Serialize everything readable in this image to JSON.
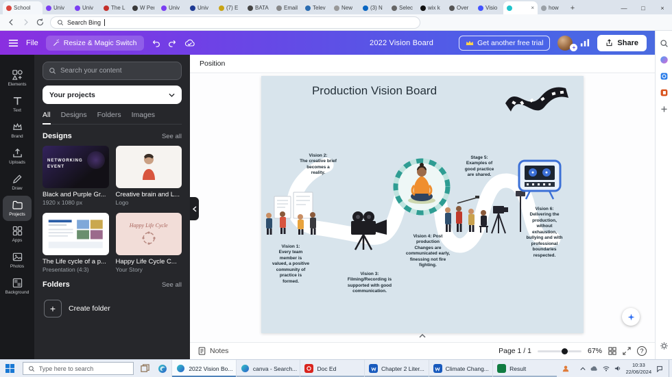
{
  "colors": {
    "toolbar_gradient_start": "#8a2fe0",
    "toolbar_gradient_end": "#4a6ae0",
    "page_background": "#d8e4ec",
    "panel_background": "#26272b"
  },
  "browser": {
    "tabs": [
      {
        "label": "School",
        "color": "#d9463e"
      },
      {
        "label": "Univ",
        "color": "#7b3ff2"
      },
      {
        "label": "Univ",
        "color": "#7b3ff2"
      },
      {
        "label": "The L",
        "color": "#c4302b"
      },
      {
        "label": "W Perel",
        "color": "#3a3a3a"
      },
      {
        "label": "Univ",
        "color": "#7b3ff2"
      },
      {
        "label": "Univ",
        "color": "#1f3a93"
      },
      {
        "label": "(7) E",
        "color": "#c8a415"
      },
      {
        "label": "BATA",
        "color": "#444444"
      },
      {
        "label": "Email",
        "color": "#888888"
      },
      {
        "label": "Telev",
        "color": "#2b6cb0"
      },
      {
        "label": "New",
        "color": "#999999"
      },
      {
        "label": "(3) N",
        "color": "#0a66c2"
      },
      {
        "label": "Selec",
        "color": "#666666"
      },
      {
        "label": "wix k",
        "color": "#111111"
      },
      {
        "label": "Over",
        "color": "#555555"
      },
      {
        "label": "Visio",
        "color": "#4353ff"
      },
      {
        "label": "",
        "color": "#20c4cb"
      },
      {
        "label": "how",
        "color": "#9aa0a6"
      }
    ],
    "tab_close_glyph": "×",
    "new_tab_label": "+",
    "window_controls": {
      "minimize": "—",
      "maximize": "□",
      "close": "×"
    },
    "address": {
      "value": "Search Bing"
    }
  },
  "toolbar": {
    "file_label": "File",
    "resize_label": "Resize & Magic Switch",
    "design_title": "2022  Vision Board",
    "trial_label": "Get another free trial",
    "share_label": "Share"
  },
  "position_bar": {
    "label": "Position"
  },
  "rail": {
    "items": [
      {
        "label": "Elements"
      },
      {
        "label": "Text"
      },
      {
        "label": "Brand"
      },
      {
        "label": "Uploads"
      },
      {
        "label": "Draw"
      },
      {
        "label": "Projects"
      },
      {
        "label": "Apps"
      },
      {
        "label": "Photos"
      },
      {
        "label": "Background"
      }
    ]
  },
  "panel": {
    "search_placeholder": "Search your content",
    "filter_label": "Your projects",
    "tabs": [
      {
        "label": "All"
      },
      {
        "label": "Designs"
      },
      {
        "label": "Folders"
      },
      {
        "label": "Images"
      }
    ],
    "designs_header": "Designs",
    "see_all": "See all",
    "designs": [
      {
        "title": "Black and Purple Gr...",
        "meta": "1920 x 1080 px",
        "thumb_line1": "NETWORKING",
        "thumb_line2": "EVENT"
      },
      {
        "title": "Creative brain and L...",
        "meta": "Logo"
      },
      {
        "title": "The Life cycle of a p...",
        "meta": "Presentation (4:3)"
      },
      {
        "title": "Happy Life Cycle C...",
        "meta": "Your Story",
        "thumb_script": "Happy Life Cycle"
      }
    ],
    "folders_header": "Folders",
    "create_folder_label": "Create folder",
    "create_folder_glyph": "+"
  },
  "canvas": {
    "title": "Production Vision Board",
    "labels": [
      {
        "text": "Vision 2:\nThe creative brief\nbecomes a\nreality."
      },
      {
        "text": "Vision 1:\nEvery team\nmember is\nvalued, a positive\ncommunity of\npractice is\nformed."
      },
      {
        "text": "Vision 3:\nFilming/Recording is\nsupported with good\ncommunication."
      },
      {
        "text": "Vision 4: Post\nproduction\nChanges are\ncommunicated early,\nfinessing not fire\nfighting."
      },
      {
        "text": "Stage 5:\nExamples of\ngood practice\nare shared."
      },
      {
        "text": "Vision 6:\nDelivering the\nproduction,\nwithout\nexhaustion,\nbullying and with\nprofessional\nboundaries\nrespected."
      }
    ]
  },
  "bottom_bar": {
    "notes_label": "Notes",
    "page_label": "Page 1 / 1",
    "zoom_label": "67%",
    "help_glyph": "?"
  },
  "taskbar": {
    "search_placeholder": "Type here to search",
    "apps": [
      {
        "label": "2022 Vision Bo..."
      },
      {
        "label": "canva - Search..."
      },
      {
        "label": "Doc Ed"
      },
      {
        "label": "Chapter 2 Liter..."
      },
      {
        "label": "Climate Chang..."
      },
      {
        "label": "Result"
      }
    ],
    "time": "10:33",
    "date": "22/06/2024"
  }
}
